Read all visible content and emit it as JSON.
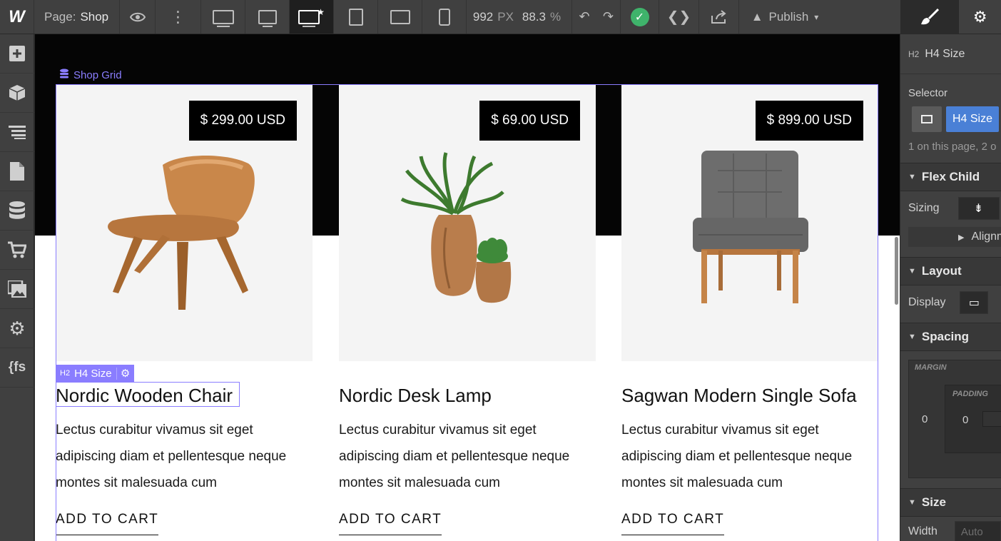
{
  "topbar": {
    "logo": "W",
    "page_label": "Page:",
    "page_name": "Shop",
    "width_value": "992",
    "width_unit": "PX",
    "zoom": "88.3",
    "zoom_unit": "%",
    "publish_label": "Publish"
  },
  "canvas": {
    "grid_label": "Shop Grid",
    "badge_tag": "H2",
    "badge_label": "H4 Size",
    "products": [
      {
        "price": "$ 299.00 USD",
        "title": "Nordic Wooden Chair",
        "description": "Lectus curabitur vivamus sit eget adipiscing diam et pellentesque neque montes sit malesuada cum",
        "cta": "ADD TO CART"
      },
      {
        "price": "$ 69.00 USD",
        "title": "Nordic Desk Lamp",
        "description": "Lectus curabitur vivamus sit eget adipiscing diam et pellentesque neque montes sit malesuada cum",
        "cta": "ADD TO CART"
      },
      {
        "price": "$ 899.00 USD",
        "title": "Sagwan Modern Single Sofa",
        "description": "Lectus curabitur vivamus sit eget adipiscing diam et pellentesque neque montes sit malesuada cum",
        "cta": "ADD TO CART"
      }
    ]
  },
  "panel": {
    "element_tag": "H2",
    "element_name": "H4 Size",
    "selector_label": "Selector",
    "selector_chip": "H4 Size",
    "selector_count": "1 on this page, 2 o",
    "flex_child": "Flex Child",
    "sizing_label": "Sizing",
    "align_label": "Alignm",
    "layout": "Layout",
    "display_label": "Display",
    "spacing": "Spacing",
    "margin_label": "MARGIN",
    "padding_label": "PADDING",
    "margin_value": "0",
    "padding_value": "0",
    "size": "Size",
    "width_label": "Width",
    "width_placeholder": "Auto"
  }
}
